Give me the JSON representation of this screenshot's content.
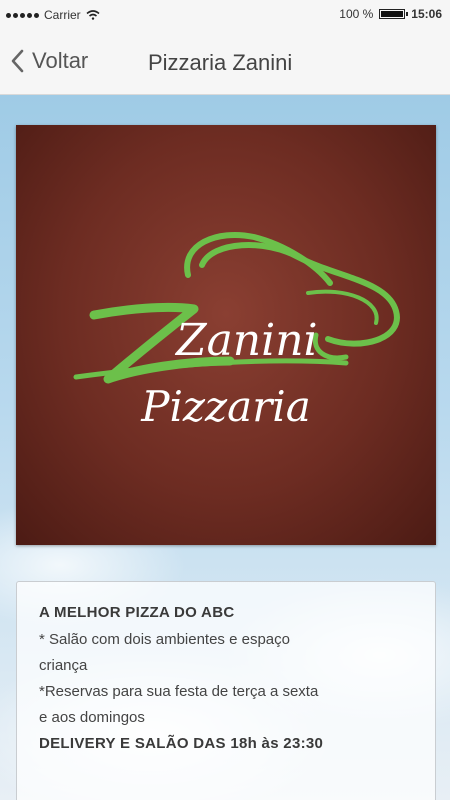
{
  "status_bar": {
    "carrier": "Carrier",
    "battery_percent": "100 %",
    "battery_level": 1.0,
    "time": "15:06"
  },
  "nav": {
    "back_label": "Voltar",
    "title": "Pizzaria Zanini"
  },
  "logo": {
    "word_top": "Zanini",
    "word_bottom": "Pizzaria"
  },
  "info": {
    "headline": "A MELHOR PIZZA DO ABC",
    "lines": [
      "* Salão com dois ambientes e espaço",
      "criança",
      "*Reservas para sua festa de terça a sexta",
      "e aos domingos"
    ],
    "footer": "DELIVERY E SALÃO DAS 18h às 23:30"
  },
  "colors": {
    "logo_background": "#6d2c22",
    "logo_green": "#6cc04a",
    "logo_white": "#ffffff"
  }
}
